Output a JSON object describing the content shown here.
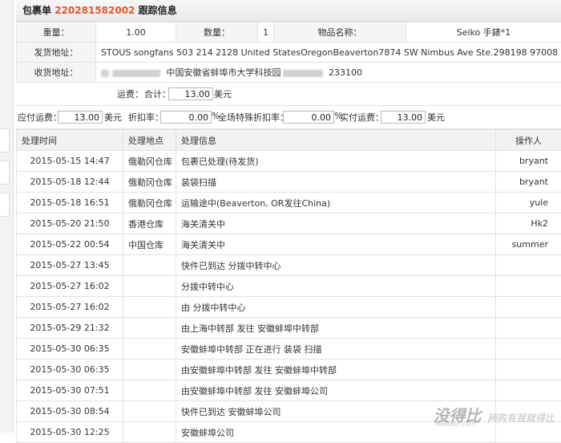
{
  "header": {
    "prefix": "包裹单",
    "number": "220281582002",
    "suffix": "跟踪信息"
  },
  "info": {
    "weight_label": "重量：",
    "weight_value": "1.00",
    "qty_label": "数量：",
    "qty_value": "1",
    "item_label": "物品名称：",
    "item_value": "Seiko 手錶*1",
    "sender_label": "发货地址：",
    "sender_value": "STOUS songfans  503 214 2128  United StatesOregonBeaverton7874 SW Nimbus Ave Ste.298198  97008",
    "receiver_label": "收货地址：",
    "receiver_value_a": "中国安徽省蚌埠市大学科技园",
    "receiver_value_b": "233100"
  },
  "fees": {
    "shipping_label": "运费：",
    "total_label": "合计：",
    "total_value": "13.00",
    "currency": "美元",
    "payable_label": "应付运费：",
    "payable_value": "13.00",
    "discount_label": "折扣率：",
    "discount_value": "0.00",
    "percent": "%",
    "special_label": "全场特殊折扣率：",
    "special_value": "0.00",
    "actual_label": "实付运费：",
    "actual_value": "13.00"
  },
  "log": {
    "headers": {
      "time": "处理时间",
      "place": "处理地点",
      "info": "处理信息",
      "operator": "操作人"
    },
    "rows": [
      {
        "time": "2015-05-15 14:47",
        "place": "俄勒冈仓库",
        "info": "包裹已处理(待发货)",
        "operator": "bryant"
      },
      {
        "time": "2015-05-18 12:44",
        "place": "俄勒冈仓库",
        "info": "装袋扫描",
        "operator": "bryant"
      },
      {
        "time": "2015-05-18 16:51",
        "place": "俄勒冈仓库",
        "info": "运输途中(Beaverton, OR发往China)",
        "operator": "yule"
      },
      {
        "time": "2015-05-20 21:50",
        "place": "香港仓库",
        "info": "海关清关中",
        "operator": "Hk2"
      },
      {
        "time": "2015-05-22 00:54",
        "place": "中国仓库",
        "info": "海关清关中",
        "operator": "summer"
      },
      {
        "time": "2015-05-27 13:45",
        "place": "",
        "info": "快件已到达 分拨中转中心",
        "operator": ""
      },
      {
        "time": "2015-05-27 16:02",
        "place": "",
        "info": "分拨中转中心",
        "operator": ""
      },
      {
        "time": "2015-05-27 16:02",
        "place": "",
        "info": "由 分拨中转中心",
        "operator": ""
      },
      {
        "time": "2015-05-29 21:32",
        "place": "",
        "info": "由上海中转部 发往 安徽蚌埠中转部",
        "operator": ""
      },
      {
        "time": "2015-05-30 06:35",
        "place": "",
        "info": "安徽蚌埠中转部 正在进行 装袋 扫描",
        "operator": ""
      },
      {
        "time": "2015-05-30 06:35",
        "place": "",
        "info": "由安徽蚌埠中转部 发往 安徽蚌埠中转部",
        "operator": ""
      },
      {
        "time": "2015-05-30 07:51",
        "place": "",
        "info": "由安徽蚌埠中转部 发往 安徽蚌埠公司",
        "operator": ""
      },
      {
        "time": "2015-05-30 08:54",
        "place": "",
        "info": "快件已到达 安徽蚌埠公司",
        "operator": ""
      },
      {
        "time": "2015-05-30 12:25",
        "place": "",
        "info": "安徽蚌埠公司",
        "operator": ""
      }
    ]
  },
  "watermark": {
    "brand": "没得比",
    "slogan": "网购有我就得比",
    "domain": "Meidebi.com"
  }
}
